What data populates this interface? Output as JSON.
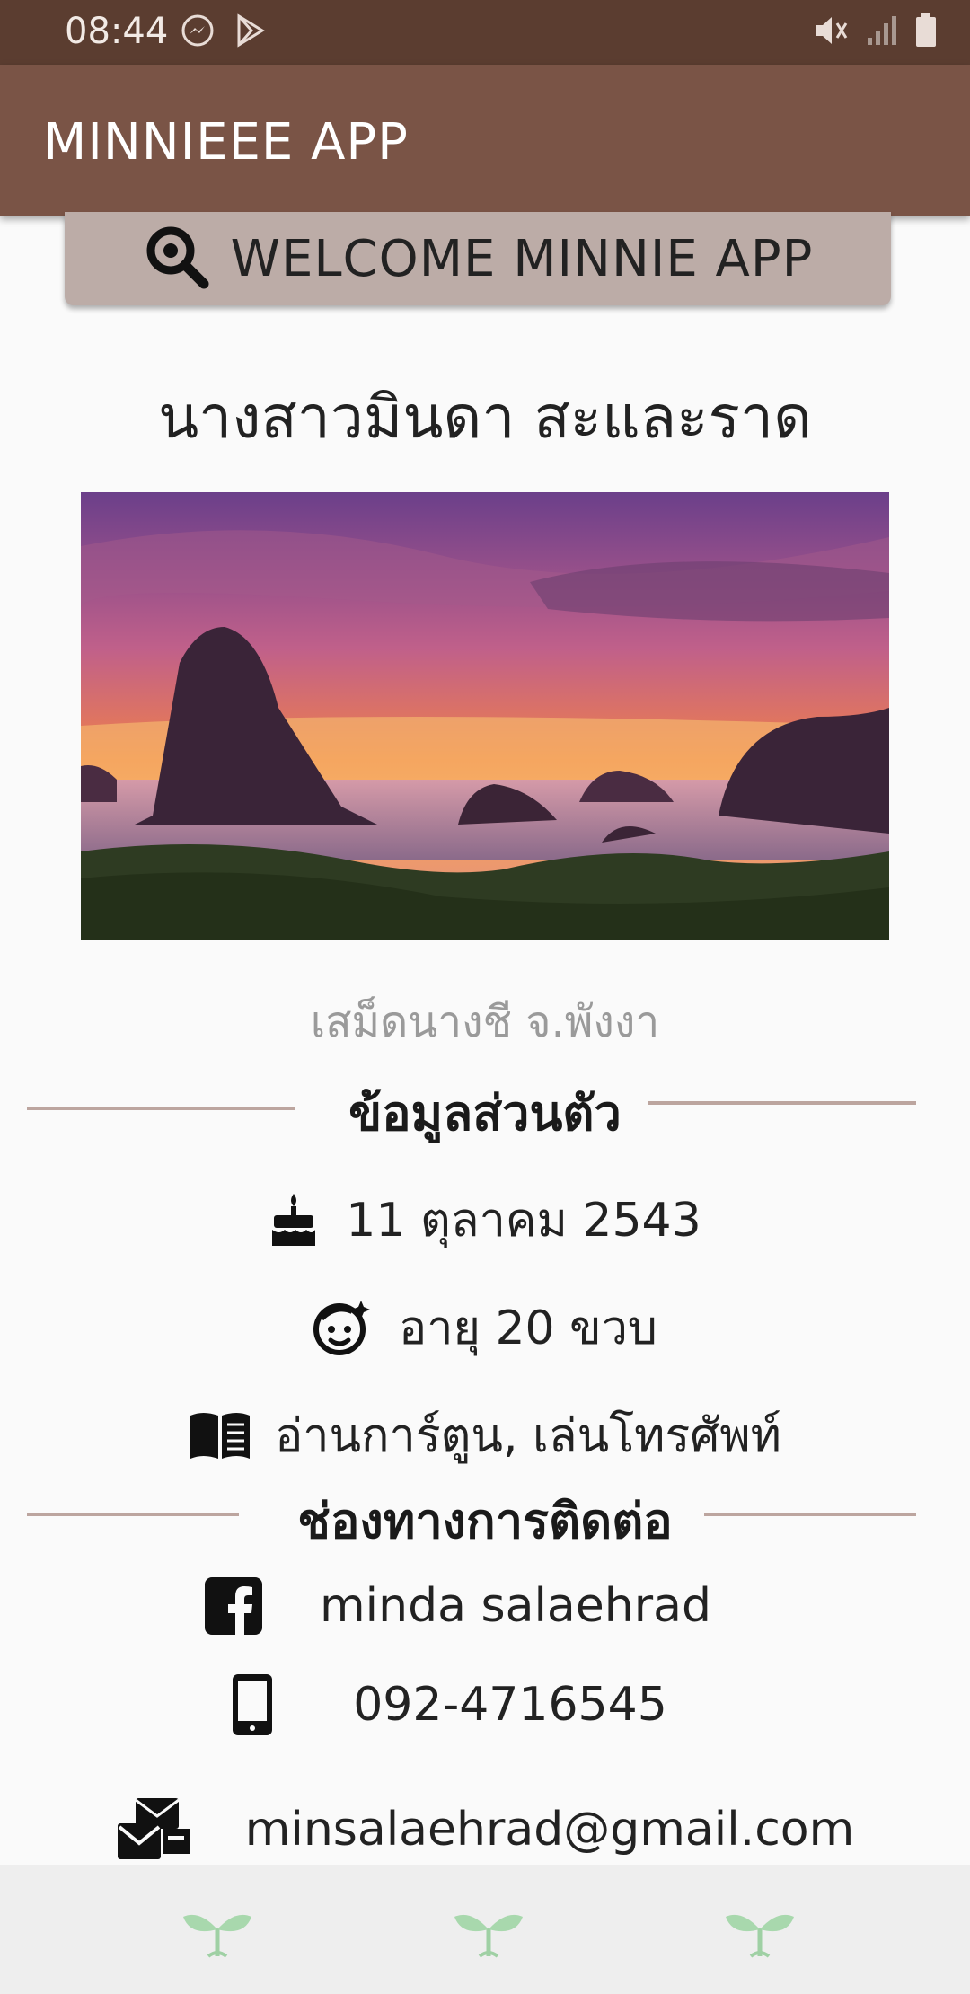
{
  "status_bar": {
    "time": "08:44",
    "left_icons": [
      "messenger-icon",
      "play-store-icon"
    ],
    "right_icons": [
      "mute-icon",
      "signal-icon",
      "battery-icon"
    ]
  },
  "app_bar": {
    "title": "MINNIEEE APP"
  },
  "welcome_button": {
    "label": "WELCOME MINNIE APP",
    "icon": "search-icon"
  },
  "profile": {
    "name": "นางสาวมินดา สะและราด",
    "photo_caption": "เสม็ดนางชี จ.พังงา"
  },
  "personal_section": {
    "title": "ข้อมูลส่วนตัว",
    "birthday": "11 ตุลาคม 2543",
    "age": "อายุ 20 ขวบ",
    "hobbies": "อ่านการ์ตูน, เล่นโทรศัพท์"
  },
  "contact_section": {
    "title": "ช่องทางการติดต่อ",
    "facebook": "minda salaehrad",
    "phone": "092-4716545",
    "email": "minsalaehrad@gmail.com"
  },
  "bottom_nav": {
    "items": [
      "sprout-icon",
      "sprout-icon",
      "sprout-icon"
    ]
  },
  "colors": {
    "status_bar": "#5b3d30",
    "app_bar": "#7a5446",
    "button": "#bcaca7",
    "divider": "#bca59f"
  }
}
